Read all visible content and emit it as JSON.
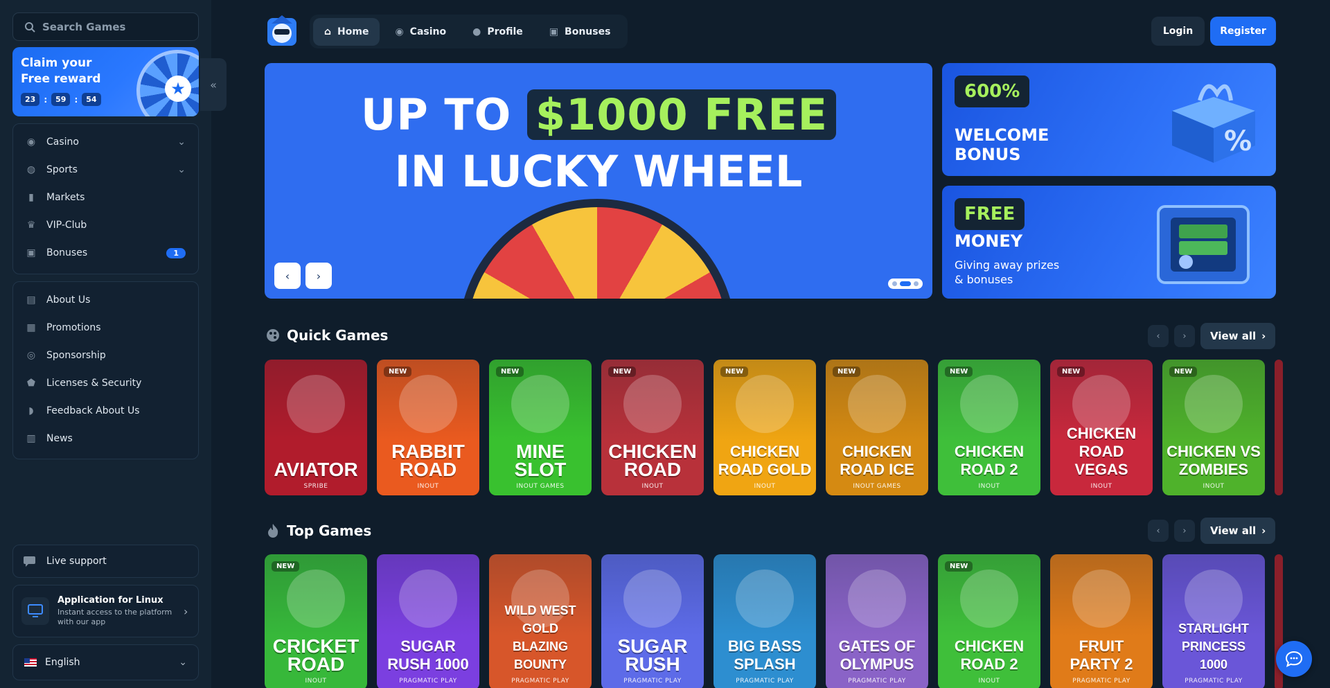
{
  "search": {
    "placeholder": "Search Games"
  },
  "promo": {
    "title": "Claim your Free reward",
    "timer": [
      "23",
      "59",
      "54"
    ]
  },
  "sidebar": {
    "main_items": [
      {
        "label": "Casino",
        "icon": "casino-chip-icon",
        "has_chevron": true
      },
      {
        "label": "Sports",
        "icon": "globe-icon",
        "has_chevron": true
      },
      {
        "label": "Markets",
        "icon": "candlestick-icon"
      },
      {
        "label": "VIP-Club",
        "icon": "crown-icon"
      },
      {
        "label": "Bonuses",
        "icon": "gift-icon",
        "badge": "1"
      }
    ],
    "info_items": [
      {
        "label": "About Us",
        "icon": "book-icon"
      },
      {
        "label": "Promotions",
        "icon": "ticket-icon"
      },
      {
        "label": "Sponsorship",
        "icon": "medal-icon"
      },
      {
        "label": "Licenses & Security",
        "icon": "shield-icon"
      },
      {
        "label": "Feedback About Us",
        "icon": "chat-bubble-icon"
      },
      {
        "label": "News",
        "icon": "newspaper-icon"
      }
    ],
    "support_label": "Live support",
    "app": {
      "title": "Application for Linux",
      "subtitle": "Instant access to the platform with our app"
    },
    "language": "English"
  },
  "header": {
    "tabs": [
      {
        "label": "Home",
        "icon": "home-icon",
        "active": true
      },
      {
        "label": "Casino",
        "icon": "casino-chip-icon"
      },
      {
        "label": "Profile",
        "icon": "user-icon"
      },
      {
        "label": "Bonuses",
        "icon": "gift-icon"
      }
    ],
    "login": "Login",
    "register": "Register"
  },
  "hero": {
    "line1_prefix": "UP TO",
    "line1_highlight": "$1000 FREE",
    "line2": "IN LUCKY WHEEL",
    "slides": 3,
    "active_slide": 2
  },
  "side_banners": [
    {
      "chip": "600%",
      "title": "WELCOME BONUS",
      "subtitle": ""
    },
    {
      "chip": "FREE",
      "title": "MONEY",
      "subtitle": "Giving away prizes & bonuses"
    }
  ],
  "quick_games": {
    "title": "Quick Games",
    "view_all": "View all",
    "games": [
      {
        "name": "AVIATOR",
        "provider": "SPRIBE",
        "new": false,
        "color": "#b11c2c"
      },
      {
        "name": "RABBIT ROAD",
        "provider": "INOUT",
        "new": true,
        "color": "#ea5a1f"
      },
      {
        "name": "MINE SLOT",
        "provider": "INOUT GAMES",
        "new": true,
        "color": "#39c12f"
      },
      {
        "name": "CHICKEN ROAD",
        "provider": "INOUT",
        "new": true,
        "color": "#b8313a"
      },
      {
        "name": "CHICKEN ROAD GOLD",
        "provider": "INOUT",
        "new": true,
        "color": "#f0a512"
      },
      {
        "name": "CHICKEN ROAD ICE",
        "provider": "INOUT GAMES",
        "new": true,
        "color": "#d58a12"
      },
      {
        "name": "CHICKEN ROAD 2",
        "provider": "INOUT",
        "new": true,
        "color": "#3fbf3a"
      },
      {
        "name": "CHICKEN ROAD VEGAS",
        "provider": "INOUT",
        "new": true,
        "color": "#c8283c"
      },
      {
        "name": "CHICKEN VS ZOMBIES",
        "provider": "INOUT",
        "new": true,
        "color": "#4fb22b"
      }
    ]
  },
  "top_games": {
    "title": "Top Games",
    "view_all": "View all",
    "games": [
      {
        "name": "CRICKET ROAD",
        "provider": "INOUT",
        "new": true,
        "color": "#37b83a"
      },
      {
        "name": "SUGAR RUSH 1000",
        "provider": "PRAGMATIC PLAY",
        "new": false,
        "color": "#7b3fe0"
      },
      {
        "name": "WILD WEST GOLD BLAZING BOUNTY",
        "provider": "PRAGMATIC PLAY",
        "new": false,
        "color": "#d7562a"
      },
      {
        "name": "SUGAR RUSH",
        "provider": "PRAGMATIC PLAY",
        "new": false,
        "color": "#5d6be8"
      },
      {
        "name": "BIG BASS SPLASH",
        "provider": "PRAGMATIC PLAY",
        "new": false,
        "color": "#2d8ed0"
      },
      {
        "name": "GATES OF OLYMPUS",
        "provider": "PRAGMATIC PLAY",
        "new": false,
        "color": "#8a63c7"
      },
      {
        "name": "CHICKEN ROAD 2",
        "provider": "INOUT",
        "new": true,
        "color": "#3fbf3a"
      },
      {
        "name": "FRUIT PARTY 2",
        "provider": "PRAGMATIC PLAY",
        "new": false,
        "color": "#e07b19"
      },
      {
        "name": "STARLIGHT PRINCESS 1000",
        "provider": "PRAGMATIC PLAY",
        "new": false,
        "color": "#6a56d8"
      }
    ]
  }
}
